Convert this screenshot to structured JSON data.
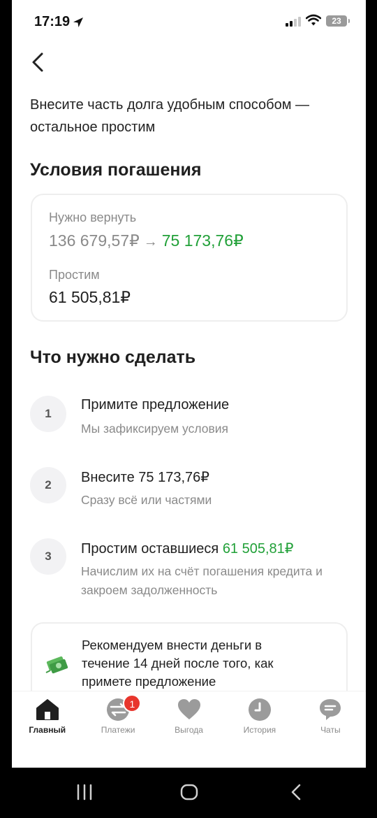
{
  "status_bar": {
    "time": "17:19",
    "battery": "23"
  },
  "intro": "Внесите часть долга удобным способом — остальное простим",
  "conditions": {
    "title": "Условия погашения",
    "need_return_label": "Нужно вернуть",
    "old_amount": "136 679,57₽",
    "arrow": "→",
    "new_amount": "75 173,76₽",
    "forgive_label": "Простим",
    "forgive_amount": "61 505,81₽"
  },
  "todo": {
    "title": "Что нужно сделать",
    "steps": [
      {
        "num": "1",
        "title": "Примите предложение",
        "sub": "Мы зафиксируем условия"
      },
      {
        "num": "2",
        "title": "Внесите 75 173,76₽",
        "sub": "Сразу всё или частями"
      },
      {
        "num": "3",
        "title": "Простим оставшиеся",
        "title_amount": "61 505,81₽",
        "sub": "Начислим их на счёт погашения кредита и закроем задолженность"
      }
    ]
  },
  "recommendation": {
    "icon": "money-icon",
    "text": "Рекомендуем внести деньги в течение 14 дней после того, как примете предложение"
  },
  "nav": {
    "items": [
      {
        "label": "Главный",
        "icon": "home-icon",
        "active": true
      },
      {
        "label": "Платежи",
        "icon": "payments-icon",
        "badge": "1"
      },
      {
        "label": "Выгода",
        "icon": "heart-icon"
      },
      {
        "label": "История",
        "icon": "clock-icon"
      },
      {
        "label": "Чаты",
        "icon": "chat-icon"
      }
    ]
  },
  "colors": {
    "accent_green": "#21a038",
    "badge_red": "#e8352c",
    "muted": "#8a8a8a"
  }
}
